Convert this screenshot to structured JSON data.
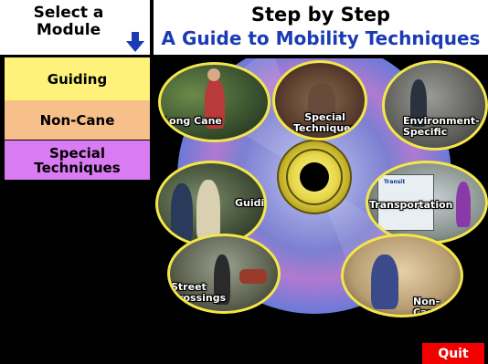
{
  "header": {
    "select_module": "Select a\nModule",
    "title": "Step by Step",
    "subtitle": "A Guide to Mobility Techniques"
  },
  "menu": {
    "items": [
      {
        "label": "Guiding",
        "color": "#fff27a"
      },
      {
        "label": "Non-Cane",
        "color": "#f7c08a"
      },
      {
        "label": "Special\nTechniques",
        "color": "#d97bf2"
      }
    ]
  },
  "modules": {
    "long_cane": "Long Cane",
    "special_techniques": "Special\nTechniques",
    "environment_specific": "Environment-\nSpecific",
    "guiding": "Guiding",
    "transportation": "Transportation",
    "street_crossings": "Street\nCrossings",
    "non_cane": "Non-Cane"
  },
  "bus_sign": "Transit",
  "quit_label": "Quit",
  "colors": {
    "subtitle": "#1a3bb3",
    "arrow": "#1a3bb3",
    "bubble_border": "#f2e64a",
    "quit_bg": "#f20000"
  },
  "icons": {
    "down_arrow": "down-arrow-icon"
  }
}
